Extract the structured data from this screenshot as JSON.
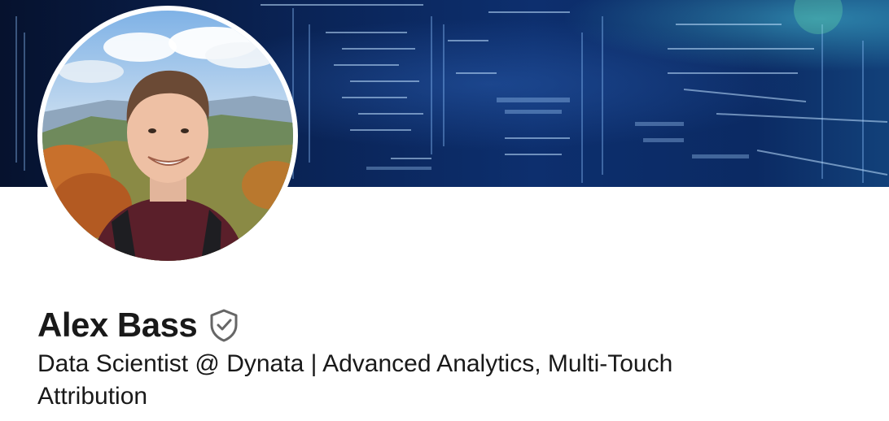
{
  "profile": {
    "name": "Alex Bass",
    "headline": "Data Scientist @ Dynata | Advanced Analytics, Multi-Touch Attribution",
    "verified_icon": "shield-check-icon"
  },
  "banner": {
    "theme": "blue-code-matrix"
  },
  "colors": {
    "text_primary": "#191919",
    "verified_icon": "#666666",
    "banner_dark": "#06122e",
    "banner_mid": "#0d2f6e"
  }
}
